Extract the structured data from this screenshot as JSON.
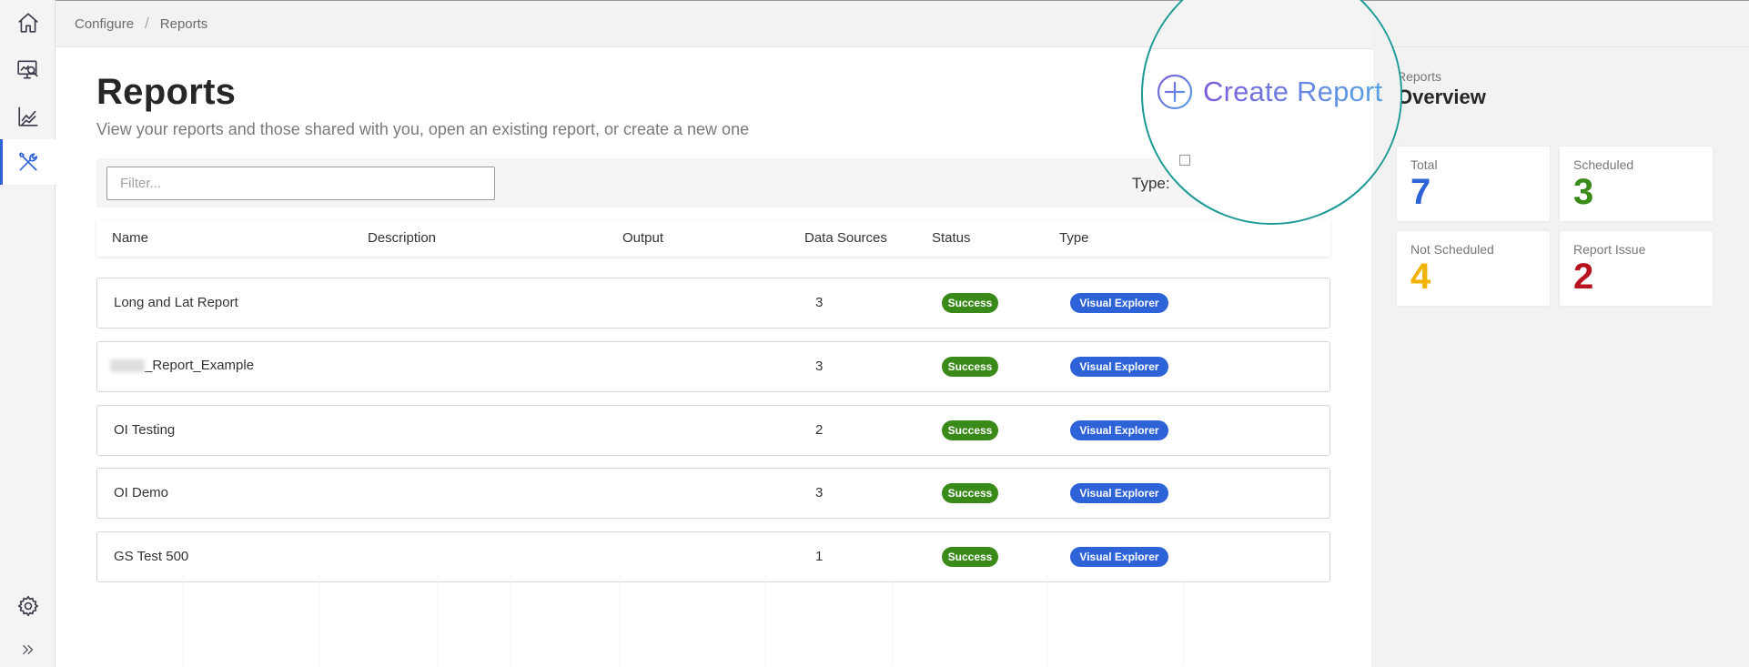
{
  "breadcrumb": {
    "items": [
      "Configure",
      "Reports"
    ],
    "separator": "/"
  },
  "nav": {
    "items": [
      {
        "icon": "home-icon",
        "active": false
      },
      {
        "icon": "monitor-search-icon",
        "active": false
      },
      {
        "icon": "line-chart-icon",
        "active": false
      },
      {
        "icon": "tools-icon",
        "active": true
      }
    ],
    "bottom": [
      {
        "icon": "gear-icon"
      },
      {
        "icon": "double-chevron-right-icon"
      }
    ]
  },
  "page": {
    "title": "Reports",
    "subtitle": "View your reports and those shared with you, open an existing report, or create a new one"
  },
  "filter": {
    "placeholder": "Filter...",
    "type_label": "Type:"
  },
  "create_button": {
    "label": "Create Report",
    "icon": "plus-circle-icon"
  },
  "table": {
    "columns": [
      "Name",
      "Description",
      "Output",
      "Data Sources",
      "Status",
      "Type"
    ],
    "rows": [
      {
        "name": "Long and Lat Report",
        "name_prefix_redacted": false,
        "description": "",
        "output": "",
        "data_sources": "3",
        "status": "Success",
        "type": "Visual Explorer"
      },
      {
        "name": "_Report_Example",
        "name_prefix_redacted": true,
        "description": "",
        "output": "",
        "data_sources": "3",
        "status": "Success",
        "type": "Visual Explorer"
      },
      {
        "name": "OI Testing",
        "name_prefix_redacted": false,
        "description": "",
        "output": "",
        "data_sources": "2",
        "status": "Success",
        "type": "Visual Explorer"
      },
      {
        "name": "OI Demo",
        "name_prefix_redacted": false,
        "description": "",
        "output": "",
        "data_sources": "3",
        "status": "Success",
        "type": "Visual Explorer"
      },
      {
        "name": "GS Test 500",
        "name_prefix_redacted": false,
        "description": "",
        "output": "",
        "data_sources": "1",
        "status": "Success",
        "type": "Visual Explorer"
      }
    ]
  },
  "overview": {
    "subtitle": "Reports",
    "title": "Overview",
    "cards": [
      {
        "label": "Total",
        "value": "7",
        "color": "#2e63d8"
      },
      {
        "label": "Scheduled",
        "value": "3",
        "color": "#3a8a1a"
      },
      {
        "label": "Not Scheduled",
        "value": "4",
        "color": "#f0b400"
      },
      {
        "label": "Report Issue",
        "value": "2",
        "color": "#b8121e"
      }
    ]
  },
  "colors": {
    "accent": "#2e63d8",
    "success": "#3a8a1a",
    "magnifier_ring": "#1c9a96"
  }
}
